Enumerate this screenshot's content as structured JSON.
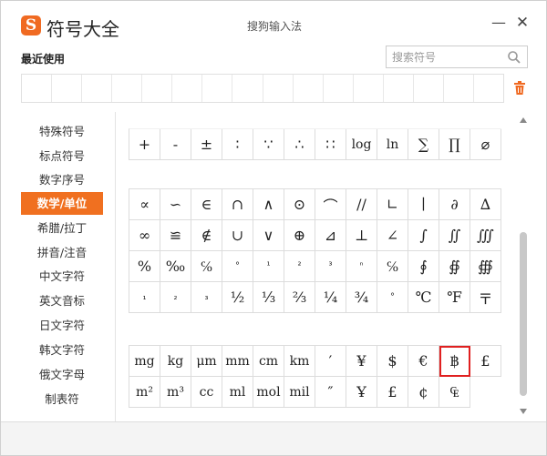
{
  "app": {
    "title": "符号大全",
    "caption": "搜狗输入法",
    "logo_letter": "S"
  },
  "recent": {
    "label": "最近使用",
    "cell_count": 16
  },
  "search": {
    "placeholder": "搜索符号"
  },
  "sidebar": {
    "items": [
      "特殊符号",
      "标点符号",
      "数字序号",
      "数学/单位",
      "希腊/拉丁",
      "拼音/注音",
      "中文字符",
      "英文音标",
      "日文字符",
      "韩文字符",
      "俄文字母",
      "制表符"
    ],
    "active_index": 3
  },
  "symbols": {
    "top_row": [
      "+",
      "-",
      "±",
      "∶",
      "∵",
      "∴",
      "∷",
      "log",
      "ln",
      "∑",
      "∏",
      "⌀"
    ],
    "math_rows": [
      [
        "∝",
        "∽",
        "∈",
        "∩",
        "∧",
        "⊙",
        "⌒",
        "//",
        "∟",
        "∣",
        "∂",
        "∆"
      ],
      [
        "∞",
        "≌",
        "∉",
        "∪",
        "∨",
        "⊕",
        "⊿",
        "⊥",
        "∠",
        "∫",
        "∬",
        "∭"
      ],
      [
        "%",
        "‰",
        "℅",
        "°",
        "¹",
        "²",
        "³",
        "ⁿ",
        "℅",
        "∮",
        "∯",
        "∰"
      ],
      [
        "₁",
        "₂",
        "₃",
        "½",
        "⅓",
        "⅔",
        "¼",
        "¾",
        "°",
        "℃",
        "℉",
        "〒"
      ]
    ],
    "unit_rows": [
      [
        "mg",
        "kg",
        "μm",
        "mm",
        "cm",
        "km",
        "′",
        "¥",
        "$",
        "€",
        "฿",
        "£"
      ],
      [
        "m²",
        "m³",
        "cc",
        "ml",
        "mol",
        "mil",
        "″",
        "Ұ",
        "£",
        "¢",
        "₠"
      ]
    ],
    "selected": "฿"
  },
  "colors": {
    "accent": "#f07020",
    "selected_border": "#e02020",
    "logo": "#f06a22"
  }
}
